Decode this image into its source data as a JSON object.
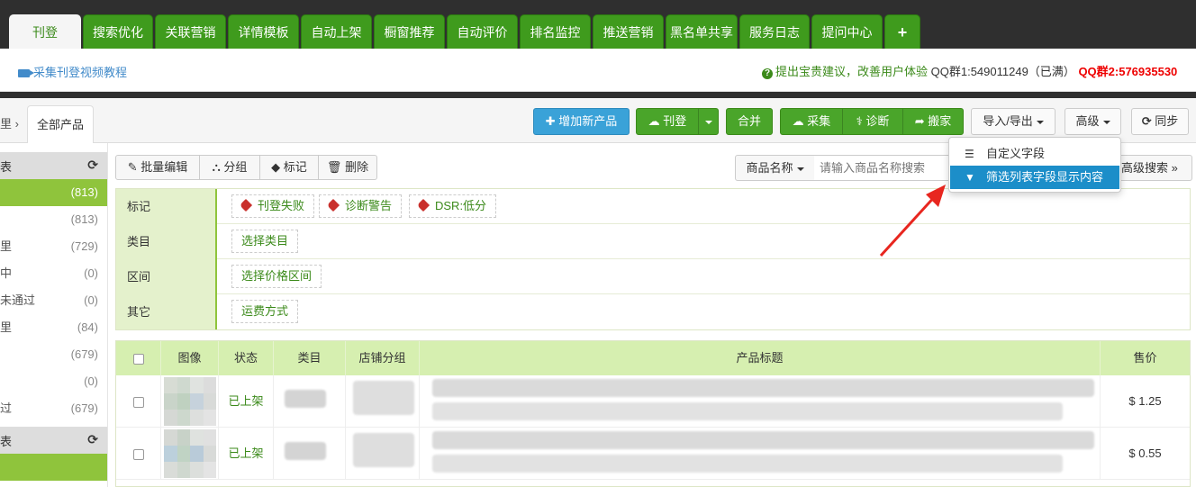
{
  "nav": {
    "tabs": [
      {
        "label": "刊登",
        "active": true
      },
      {
        "label": "搜索优化"
      },
      {
        "label": "关联营销"
      },
      {
        "label": "详情模板"
      },
      {
        "label": "自动上架"
      },
      {
        "label": "橱窗推荐"
      },
      {
        "label": "自动评价"
      },
      {
        "label": "排名监控"
      },
      {
        "label": "推送营销"
      },
      {
        "label": "黑名单共享"
      },
      {
        "label": "服务日志"
      },
      {
        "label": "提问中心"
      },
      {
        "label": "+"
      }
    ]
  },
  "info": {
    "video_link": "采集刊登视频教程",
    "suggest_icon": "question-icon",
    "suggest": "提出宝贵建议，改善用户体验",
    "qq1": "QQ群1:549011249（已满）",
    "qq2": "QQ群2:576935530"
  },
  "breadcrumb": {
    "arrow": "里 ›",
    "all_tab": "全部产品"
  },
  "toolbar": {
    "add_product": "增加新产品",
    "publish": "刊登",
    "merge": "合并",
    "collect": "采集",
    "diagnose": "诊断",
    "move": "搬家",
    "import_export": "导入/导出",
    "advanced": "高级",
    "sync": "同步"
  },
  "actions": {
    "bulk_edit": "批量编辑",
    "group": "分组",
    "mark": "标记",
    "delete": "删除",
    "search_field": "商品名称",
    "search_placeholder": "请输入商品名称搜索",
    "advanced_search": "高级搜索"
  },
  "dropdown": {
    "items": [
      {
        "label": "自定义字段",
        "icon": "list-icon"
      },
      {
        "label": "筛选列表字段显示内容",
        "icon": "filter-icon",
        "active": true
      }
    ]
  },
  "sidebar": {
    "groups": [
      {
        "title": "表",
        "items": [
          {
            "label": "",
            "count": "(813)",
            "active": true
          },
          {
            "label": "",
            "count": "(813)"
          },
          {
            "label": "里",
            "count": "(729)"
          },
          {
            "label": "中",
            "count": "(0)"
          },
          {
            "label": "未通过",
            "count": "(0)"
          },
          {
            "label": "里",
            "count": "(84)"
          },
          {
            "label": "",
            "count": "(679)"
          },
          {
            "label": "",
            "count": "(0)"
          },
          {
            "label": "过",
            "count": "(679)"
          }
        ]
      },
      {
        "title": "表",
        "items": [
          {
            "label": "",
            "count": "",
            "active": true
          }
        ]
      }
    ]
  },
  "filters": {
    "mark": {
      "label": "标记",
      "chips": [
        "刊登失败",
        "诊断警告",
        "DSR:低分"
      ]
    },
    "category": {
      "label": "类目",
      "chip": "选择类目"
    },
    "range": {
      "label": "区间",
      "chip": "选择价格区间"
    },
    "other": {
      "label": "其它",
      "chip": "运费方式"
    }
  },
  "table": {
    "columns": [
      "图像",
      "状态",
      "类目",
      "店铺分组",
      "产品标题",
      "售价"
    ],
    "rows": [
      {
        "status": "已上架",
        "price": "$ 1.25"
      },
      {
        "status": "已上架",
        "price": "$ 0.55"
      }
    ]
  },
  "colors": {
    "nav_green": "#3f9b1d",
    "accent_green": "#8fc43c",
    "header_green": "#d6efb0",
    "link_blue": "#428bca",
    "dropdown_active": "#1c8ec9",
    "qq2_red": "#e00000"
  }
}
